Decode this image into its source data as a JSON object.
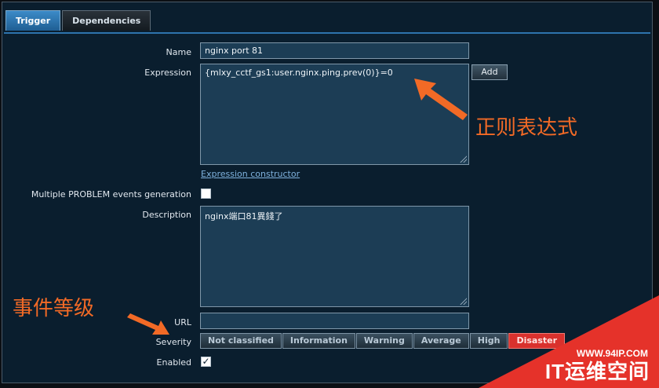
{
  "tabs": [
    {
      "label": "Trigger",
      "active": true
    },
    {
      "label": "Dependencies",
      "active": false
    }
  ],
  "form": {
    "name_label": "Name",
    "name_value": "nginx port 81",
    "expression_label": "Expression",
    "expression_value": "{mlxy_cctf_gs1:user.nginx.ping.prev(0)}=0",
    "add_button": "Add",
    "expression_constructor_link": "Expression constructor",
    "multiple_problem_label": "Multiple PROBLEM events generation",
    "multiple_problem_checked": false,
    "description_label": "Description",
    "description_value": "nginx端口81異錢了",
    "url_label": "URL",
    "url_value": "",
    "severity_label": "Severity",
    "severity_options": [
      "Not classified",
      "Information",
      "Warning",
      "Average",
      "High",
      "Disaster"
    ],
    "severity_selected": "Disaster",
    "enabled_label": "Enabled",
    "enabled_checked": true
  },
  "annotations": {
    "regex_note": "正则表达式",
    "severity_note": "事件等级",
    "accent_color": "#f26a26"
  },
  "watermark": {
    "url": "WWW.94IP.COM",
    "brand": "IT运维空间"
  },
  "colors": {
    "active_tab": "#2e74ad",
    "disaster": "#d9312d",
    "panel_bg": "#0a1e2e",
    "input_bg": "#1c3d55"
  }
}
